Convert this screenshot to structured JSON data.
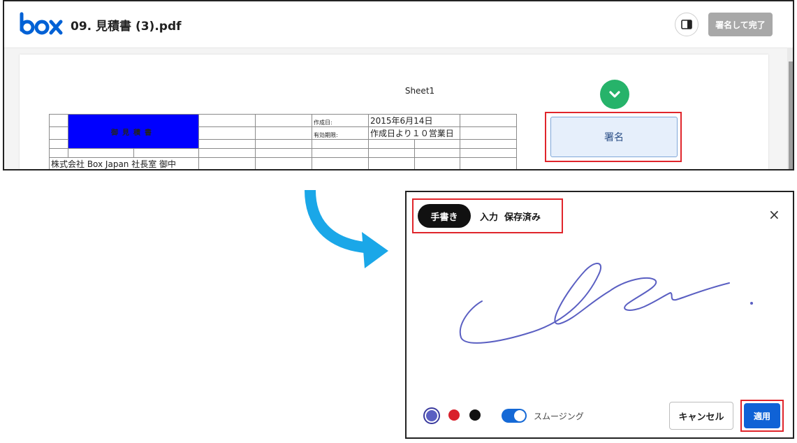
{
  "viewer": {
    "file_title": "09. 見積書 (3).pdf",
    "finish_button": "署名して完了",
    "sheet_label": "Sheet1",
    "quote_title": "御見積書",
    "created_label": "作成日:",
    "created_value": "2015年6月14日",
    "valid_label": "有効期限:",
    "valid_value": "作成日より１０営業日",
    "recipient": "株式会社 Box Japan 社長室 御中",
    "sign_field_label": "署名"
  },
  "dialog": {
    "tabs": [
      {
        "label": "手書き",
        "active": true
      },
      {
        "label": "入力",
        "active": false
      },
      {
        "label": "保存済み",
        "active": false
      }
    ],
    "close_label": "×",
    "colors": [
      "#5a5fc2",
      "#d9202b",
      "#111111"
    ],
    "selected_color": "#5a5fc2",
    "smoothing_label": "スムージング",
    "smoothing_on": true,
    "cancel_button": "キャンセル",
    "apply_button": "適用"
  },
  "theme": {
    "brand_blue": "#0061d5",
    "accent_red_highlight": "#e0252b",
    "check_green": "#26b36a",
    "arrow_color": "#1aa7e8"
  }
}
